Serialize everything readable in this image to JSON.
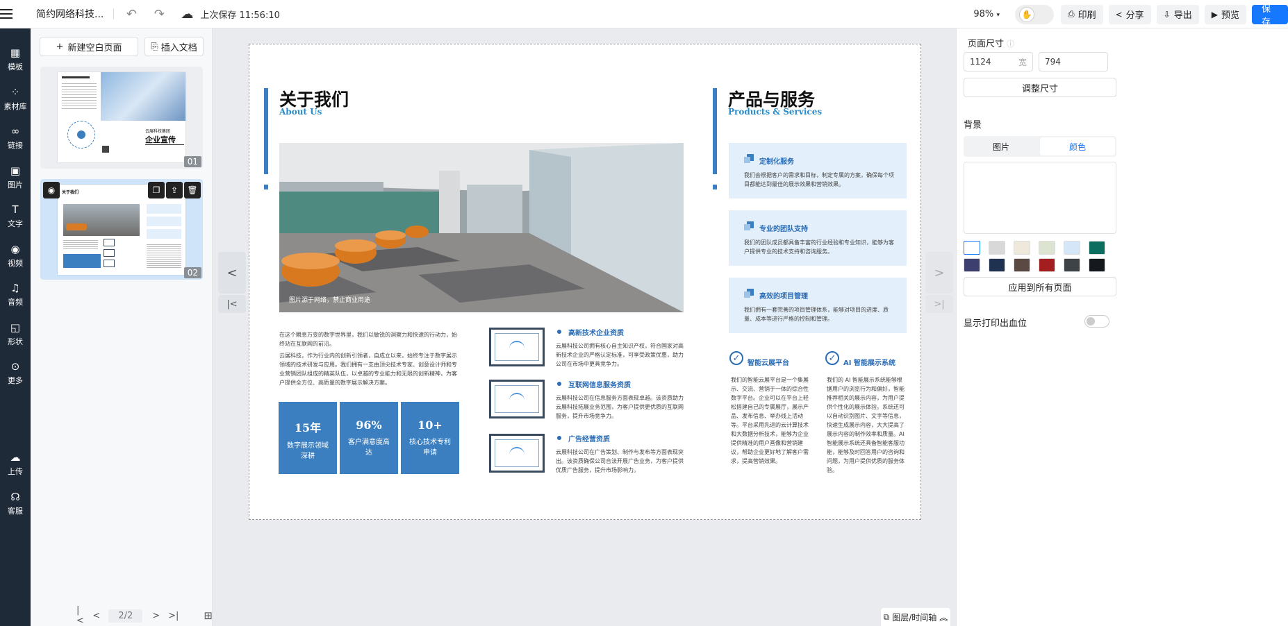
{
  "topbar": {
    "doc_title": "简约网络科技...",
    "save_status": "上次保存 11:56:10",
    "zoom": "98%",
    "buttons": {
      "print": "印刷",
      "share": "分享",
      "export": "导出",
      "preview": "预览",
      "save": "保存"
    }
  },
  "sidebar": {
    "items": [
      {
        "label": "模板",
        "icon": "template-icon"
      },
      {
        "label": "素材库",
        "icon": "material-icon"
      },
      {
        "label": "链接",
        "icon": "link-icon"
      },
      {
        "label": "图片",
        "icon": "image-icon"
      },
      {
        "label": "文字",
        "icon": "text-icon"
      },
      {
        "label": "视频",
        "icon": "video-icon"
      },
      {
        "label": "音频",
        "icon": "audio-icon"
      },
      {
        "label": "形状",
        "icon": "shape-icon"
      },
      {
        "label": "更多",
        "icon": "more-icon"
      }
    ],
    "bottom_items": [
      {
        "label": "上传",
        "icon": "upload-icon"
      },
      {
        "label": "客服",
        "icon": "support-icon"
      }
    ]
  },
  "pages_panel": {
    "new_page": "新建空白页面",
    "insert_doc": "插入文档",
    "thumbs": [
      {
        "num": "01",
        "title": "企业宣传",
        "sub": "云展科技集团"
      },
      {
        "num": "02",
        "title": "关于我们"
      }
    ],
    "pager": "2/2"
  },
  "canvas": {
    "about": {
      "title_cn": "关于我们",
      "title_en": "About Us",
      "photo_caption": "图片源于网络，禁止商业用途",
      "para1": "在这个瞬息万变的数字世界里，我们以敏锐的洞察力和快速的行动力，始终站在互联网的前沿。",
      "para2": "云展科技，作为行业内的创新引领者，自成立以来，始终专注于数字展示领域的技术研发与应用。我们拥有一支由顶尖技术专家、创意设计师和专业营销团队组成的精英队伍，以卓越的专业能力和无限的创新精神，为客户提供全方位、高质量的数字展示解决方案。",
      "stats": [
        {
          "value": "15年",
          "label": "数字展示领域深耕"
        },
        {
          "value": "96%",
          "label": "客户满意度高达"
        },
        {
          "value": "10+",
          "label": "核心技术专利申请"
        }
      ],
      "qualifications": [
        {
          "title": "高新技术企业资质",
          "text": "云展科技公司拥有核心自主知识产权，符合国家对高新技术企业的严格认定标准，可享受政策优惠，助力公司在市场中更具竞争力。"
        },
        {
          "title": "互联网信息服务资质",
          "text": "云展科技公司在信息服务方面表现卓越。该资质助力云展科技拓展业务范围，为客户提供更优质的互联网服务，提升市场竞争力。"
        },
        {
          "title": "广告经营资质",
          "text": "云展科技公司在广告策划、制作与发布等方面表现突出。该资质确保公司合法开展广告业务，为客户提供优质广告服务，提升市场影响力。"
        }
      ]
    },
    "products": {
      "title_cn": "产品与服务",
      "title_en": "Products & Services",
      "services": [
        {
          "title": "定制化服务",
          "text": "我们会根据客户的需求和目标，制定专属的方案，确保每个项目都能达到最佳的展示效果和营销效果。"
        },
        {
          "title": "专业的团队支持",
          "text": "我们的团队成员都具备丰富的行业经验和专业知识，能够为客户提供专业的技术支持和咨询服务。"
        },
        {
          "title": "高效的项目管理",
          "text": "我们拥有一套完善的项目管理体系，能够对项目的进度、质量、成本等进行严格的控制和管理。"
        }
      ],
      "platforms": [
        {
          "title": "智能云展平台",
          "text": "我们的智能云展平台是一个集展示、交流、营销于一体的综合性数字平台。企业可以在平台上轻松搭建自己的专属展厅，展示产品、发布信息、举办线上活动等。平台采用先进的云计算技术和大数据分析技术，能够为企业提供精准的用户画像和营销建议，帮助企业更好地了解客户需求，提高营销效果。"
        },
        {
          "title": "AI 智能展示系统",
          "text": "我们的 AI 智能展示系统能够根据用户的浏览行为和偏好，智能推荐相关的展示内容，为用户提供个性化的展示体验。系统还可以自动识别图片、文字等信息，快速生成展示内容，大大提高了展示内容的制作效率和质量。AI 智能展示系统还具备智能客服功能，能够及时回答用户的咨询和问题，为用户提供优质的服务体验。"
        }
      ]
    },
    "layer_btn": "图层/时间轴"
  },
  "right_panel": {
    "page_size_label": "页面尺寸",
    "width": "1124",
    "width_unit": "宽",
    "height": "794",
    "resize_btn": "调整尺寸",
    "bg_label": "背景",
    "bg_tabs": [
      "图片",
      "颜色"
    ],
    "apply_all": "应用到所有页面",
    "bleed_label": "显示打印出血位",
    "swatches": [
      "#ffffff",
      "#d8d8d8",
      "#efe9dc",
      "#dde3d1",
      "#d6e6f9",
      "#0b6e5f",
      "#3d3f6e",
      "#1f3350",
      "#5a4a43",
      "#a31e1e",
      "#3e4348",
      "#15191d"
    ]
  },
  "colors": {
    "accent": "#1677ff",
    "brand_blue": "#3b7fc0",
    "sidebar_bg": "#1f2a38"
  }
}
